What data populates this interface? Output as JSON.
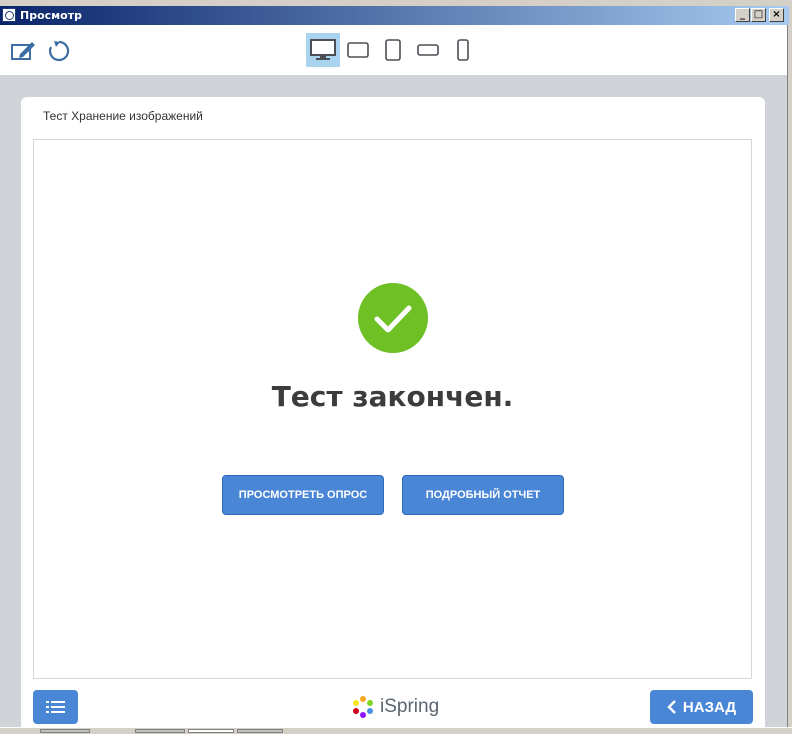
{
  "window": {
    "title": "Просмотр"
  },
  "toolbar": {
    "edit_icon": "edit-icon",
    "refresh_icon": "refresh-icon",
    "devices": [
      {
        "name": "desktop",
        "active": true
      },
      {
        "name": "tablet-landscape",
        "active": false
      },
      {
        "name": "tablet-portrait",
        "active": false
      },
      {
        "name": "phone-landscape",
        "active": false
      },
      {
        "name": "phone-portrait",
        "active": false
      }
    ]
  },
  "quiz": {
    "title": "Тест Хранение изображений",
    "result_text": "Тест закончен.",
    "review_button": "ПРОСМОТРЕТЬ ОПРОС",
    "report_button": "ПОДРОБНЫЙ ОТЧЕТ"
  },
  "footer": {
    "logo_text": "iSpring",
    "back_button": "НАЗАД"
  },
  "colors": {
    "accent": "#4a86d6",
    "success": "#6ec024",
    "active_device": "#a9d3ee"
  }
}
